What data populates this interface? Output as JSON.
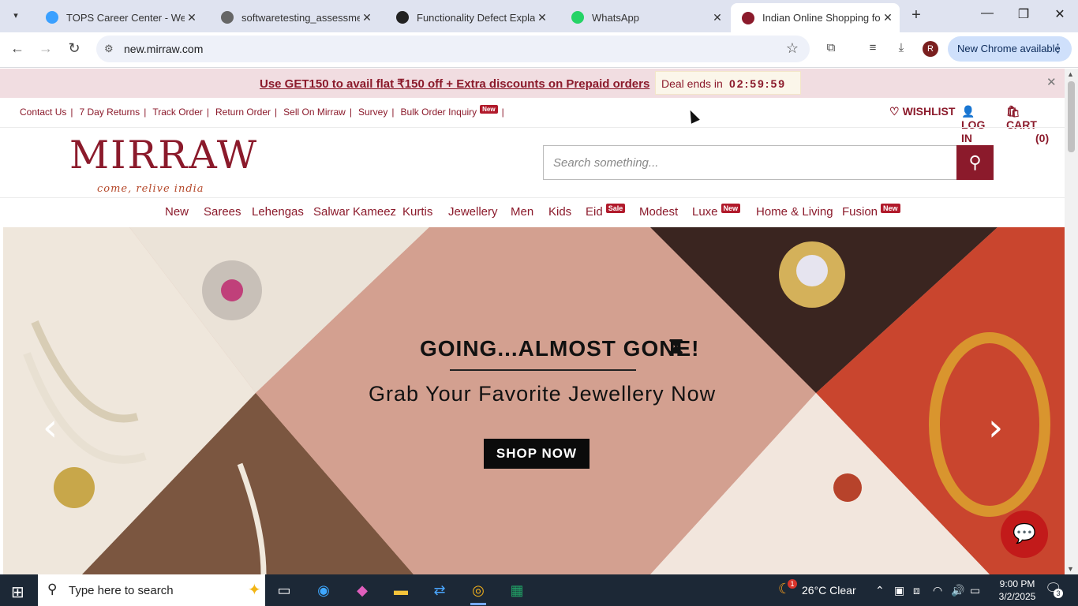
{
  "browser": {
    "tabs": [
      {
        "title": "TOPS Career Center - Welco",
        "active": false
      },
      {
        "title": "softwaretesting_assessment_",
        "active": false
      },
      {
        "title": "Functionality Defect Explana",
        "active": false
      },
      {
        "title": "WhatsApp",
        "active": false
      },
      {
        "title": "Indian Online Shopping for",
        "active": true
      }
    ],
    "url": "new.mirraw.com",
    "update_label": "New Chrome available",
    "profile_initial": "R"
  },
  "promo": {
    "message": "Use GET150 to avail flat ₹150 off + Extra discounts on Prepaid orders",
    "deal_label": "Deal ends in",
    "deal_time": "02:59:59"
  },
  "utility_links": [
    "Contact Us",
    "7 Day Returns",
    "Track Order",
    "Return Order",
    "Sell On Mirraw",
    "Survey",
    "Bulk Order Inquiry"
  ],
  "utility_new_badge": "New",
  "account": {
    "wishlist": "WISHLIST",
    "login": "LOG IN",
    "cart": "CART",
    "cart_count": "(0)"
  },
  "logo": {
    "word": "MIRRAW",
    "tagline": "come, relive india"
  },
  "search": {
    "placeholder": "Search something..."
  },
  "categories": [
    {
      "label": "New",
      "badge": ""
    },
    {
      "label": "Sarees",
      "badge": ""
    },
    {
      "label": "Lehengas",
      "badge": ""
    },
    {
      "label": "Salwar Kameez",
      "badge": ""
    },
    {
      "label": "Kurtis",
      "badge": ""
    },
    {
      "label": "Jewellery",
      "badge": ""
    },
    {
      "label": "Men",
      "badge": ""
    },
    {
      "label": "Kids",
      "badge": ""
    },
    {
      "label": "Eid",
      "badge": "Sale"
    },
    {
      "label": "Modest",
      "badge": ""
    },
    {
      "label": "Luxe",
      "badge": "New"
    },
    {
      "label": "Home & Living",
      "badge": ""
    },
    {
      "label": "Fusion",
      "badge": "New"
    }
  ],
  "hero": {
    "headline": "GOING...ALMOST GONE!",
    "subheadline": "Grab Your Favorite Jewellery Now",
    "cta": "SHOP NOW"
  },
  "taskbar": {
    "search_placeholder": "Type here to search",
    "weather": "26°C  Clear",
    "time": "9:00 PM",
    "date": "3/2/2025",
    "notifications": "3",
    "weather_alert": "1"
  },
  "colors": {
    "brand": "#8b1a2b",
    "promo_bg": "#f1dde1",
    "hero_bg": "#d9a79b"
  }
}
